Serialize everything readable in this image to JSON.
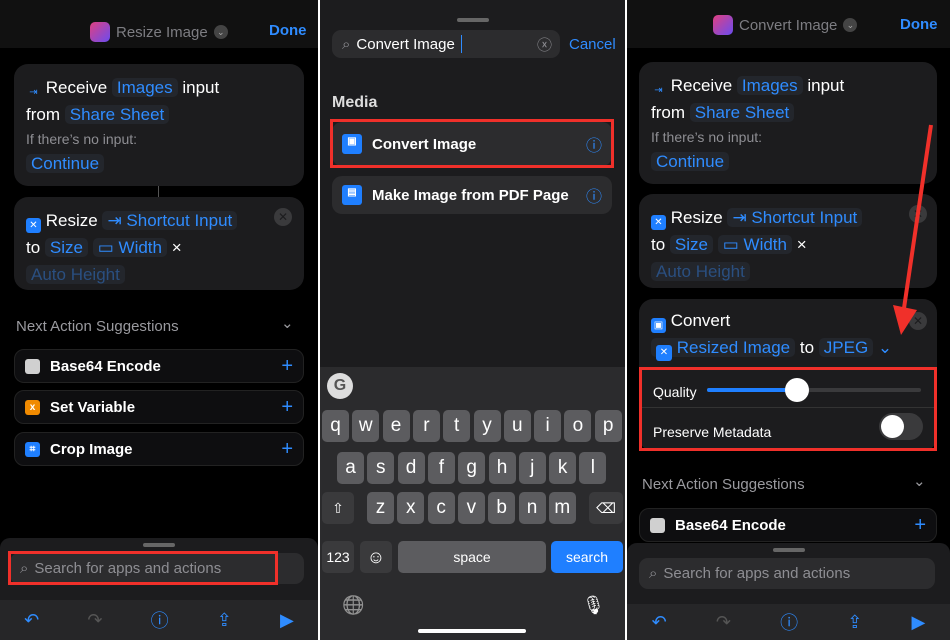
{
  "panel1": {
    "title": "Resize Image",
    "done": "Done",
    "receive": {
      "label": "Receive",
      "type": "Images",
      "input": "input",
      "from": "from",
      "source": "Share Sheet",
      "no_input": "If there’s no input:",
      "fallback": "Continue"
    },
    "resize": {
      "label": "Resize",
      "input": "Shortcut Input",
      "to": "to",
      "size": "Size",
      "width": "Width",
      "x": "×",
      "height": "Auto Height"
    },
    "suggestions_title": "Next Action Suggestions",
    "suggestions": [
      {
        "label": "Base64 Encode",
        "color": "#d0d0d0"
      },
      {
        "label": "Set Variable",
        "color": "#f08a00"
      },
      {
        "label": "Crop Image",
        "color": "#1f7fff"
      }
    ],
    "search_placeholder": "Search for apps and actions"
  },
  "panel2": {
    "search_value": "Convert Image",
    "cancel": "Cancel",
    "section": "Media",
    "results": [
      {
        "label": "Convert Image"
      },
      {
        "label": "Make Image from PDF Page"
      }
    ],
    "keyboard": {
      "row1": [
        "q",
        "w",
        "e",
        "r",
        "t",
        "y",
        "u",
        "i",
        "o",
        "p"
      ],
      "row2": [
        "a",
        "s",
        "d",
        "f",
        "g",
        "h",
        "j",
        "k",
        "l"
      ],
      "row3": [
        "z",
        "x",
        "c",
        "v",
        "b",
        "n",
        "m"
      ],
      "num": "123",
      "space": "space",
      "search": "search",
      "shift": "⇧",
      "del": "⌫",
      "emoji": "☺",
      "globe": "🌐",
      "mic": "🎙"
    }
  },
  "panel3": {
    "title": "Convert Image",
    "done": "Done",
    "receive": {
      "label": "Receive",
      "type": "Images",
      "input": "input",
      "from": "from",
      "source": "Share Sheet",
      "no_input": "If there’s no input:",
      "fallback": "Continue"
    },
    "resize": {
      "label": "Resize",
      "input": "Shortcut Input",
      "to": "to",
      "size": "Size",
      "width": "Width",
      "x": "×",
      "height": "Auto Height"
    },
    "convert": {
      "label": "Convert",
      "input": "Resized Image",
      "to": "to",
      "format": "JPEG",
      "quality_label": "Quality",
      "quality_value": 0.42,
      "metadata_label": "Preserve Metadata",
      "metadata_on": false
    },
    "suggestions_title": "Next Action Suggestions",
    "suggestions": [
      {
        "label": "Base64 Encode"
      }
    ],
    "search_placeholder": "Search for apps and actions"
  },
  "colors": {
    "accent": "#2f8cff",
    "highlight": "#f0302a"
  }
}
